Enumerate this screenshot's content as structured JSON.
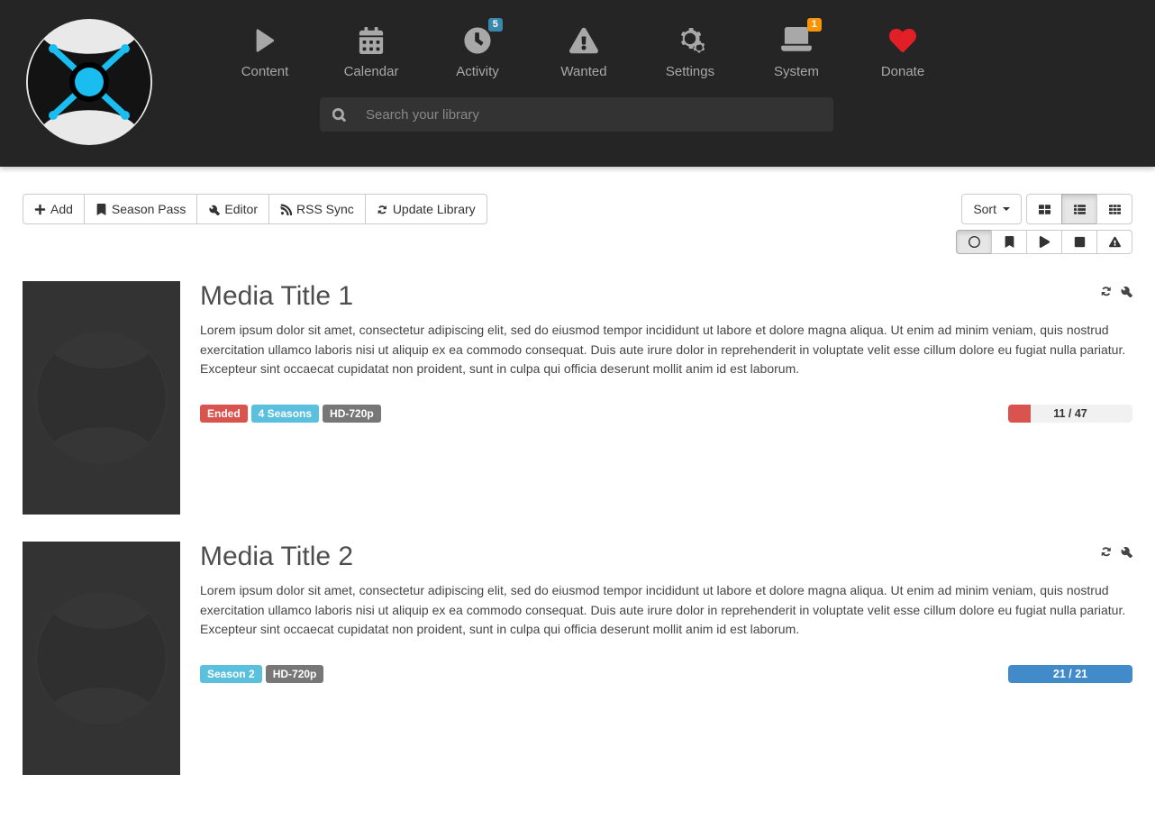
{
  "nav": {
    "items": [
      {
        "label": "Content"
      },
      {
        "label": "Calendar"
      },
      {
        "label": "Activity",
        "badge": "5",
        "badge_style": "info"
      },
      {
        "label": "Wanted"
      },
      {
        "label": "Settings"
      },
      {
        "label": "System",
        "badge": "1",
        "badge_style": "warning"
      },
      {
        "label": "Donate"
      }
    ]
  },
  "search": {
    "placeholder": "Search your library"
  },
  "toolbar": {
    "add": "Add",
    "season_pass": "Season Pass",
    "editor": "Editor",
    "rss_sync": "RSS Sync",
    "update_library": "Update Library",
    "sort": "Sort"
  },
  "media": [
    {
      "title": "Media Title 1",
      "description": "Lorem ipsum dolor sit amet, consectetur adipiscing elit, sed do eiusmod tempor incididunt ut labore et dolore magna aliqua. Ut enim ad minim veniam, quis nostrud exercitation ullamco laboris nisi ut aliquip ex ea commodo consequat. Duis aute irure dolor in reprehenderit in voluptate velit esse cillum dolore eu fugiat nulla pariatur. Excepteur sint occaecat cupidatat non proident, sunt in culpa qui officia deserunt mollit anim id est laborum.",
      "labels": [
        {
          "text": "Ended",
          "class": "label-danger"
        },
        {
          "text": "4 Seasons",
          "class": "label-info"
        },
        {
          "text": "HD-720p",
          "class": "label-default"
        }
      ],
      "progress": {
        "text": "11 / 47",
        "percent": 18,
        "full": false
      }
    },
    {
      "title": "Media Title 2",
      "description": "Lorem ipsum dolor sit amet, consectetur adipiscing elit, sed do eiusmod tempor incididunt ut labore et dolore magna aliqua. Ut enim ad minim veniam, quis nostrud exercitation ullamco laboris nisi ut aliquip ex ea commodo consequat. Duis aute irure dolor in reprehenderit in voluptate velit esse cillum dolore eu fugiat nulla pariatur. Excepteur sint occaecat cupidatat non proident, sunt in culpa qui officia deserunt mollit anim id est laborum.",
      "labels": [
        {
          "text": "Season 2",
          "class": "label-info"
        },
        {
          "text": "HD-720p",
          "class": "label-default"
        }
      ],
      "progress": {
        "text": "21 / 21",
        "percent": 100,
        "full": true
      }
    }
  ]
}
